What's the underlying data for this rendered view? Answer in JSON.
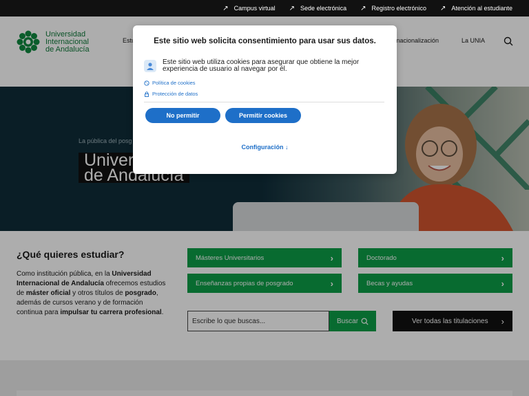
{
  "topbar": {
    "links": [
      {
        "label": "Campus virtual"
      },
      {
        "label": "Sede electrónica"
      },
      {
        "label": "Registro electrónico"
      },
      {
        "label": "Atención al estudiante"
      }
    ]
  },
  "header": {
    "logo_lines": [
      "Universidad",
      "Internacional",
      "de Andalucía"
    ],
    "nav_partial_left": "Estu",
    "nav_partial_right": "nternacionalización",
    "nav_unia": "La UNIA"
  },
  "hero": {
    "tagline_partial": "La pública del posg",
    "title_line1_partial": "Univer",
    "title_line2": "de Andalucía"
  },
  "study": {
    "title": "¿Qué quieres estudiar?",
    "desc": {
      "p1": "Como institución pública, en la ",
      "b1": "Universidad Internacional de Andalucía",
      "p2": " ofrecemos estudios de ",
      "b2": "máster oficial",
      "p3": " y otros títulos de ",
      "b3": "posgrado",
      "p4": ", además de cursos verano y de formación continua para ",
      "b4": "impulsar tu carrera profesional",
      "p5": "."
    },
    "buttons": [
      {
        "label": "Másteres Universitarios"
      },
      {
        "label": "Doctorado"
      },
      {
        "label": "Enseñanzas propias de posgrado"
      },
      {
        "label": "Becas y ayudas"
      }
    ],
    "search_placeholder": "Escribe lo que buscas...",
    "search_button": "Buscar",
    "all_button": "Ver todas las titulaciones"
  },
  "dialog": {
    "title": "Este sitio web solicita consentimiento para usar sus datos.",
    "message": "Este sitio web utiliza cookies para asegurar que obtiene la mejor experiencia de usuario al navegar por él.",
    "cookie_policy": "Política de cookies",
    "data_protection": "Protección de datos",
    "deny": "No permitir",
    "allow": "Permitir cookies",
    "settings": "Configuración ↓"
  },
  "colors": {
    "brand_green": "#0d9e48",
    "logo_green": "#0f7a3a",
    "dialog_blue": "#1e6fc8",
    "hero_dark": "#0f2d39"
  }
}
